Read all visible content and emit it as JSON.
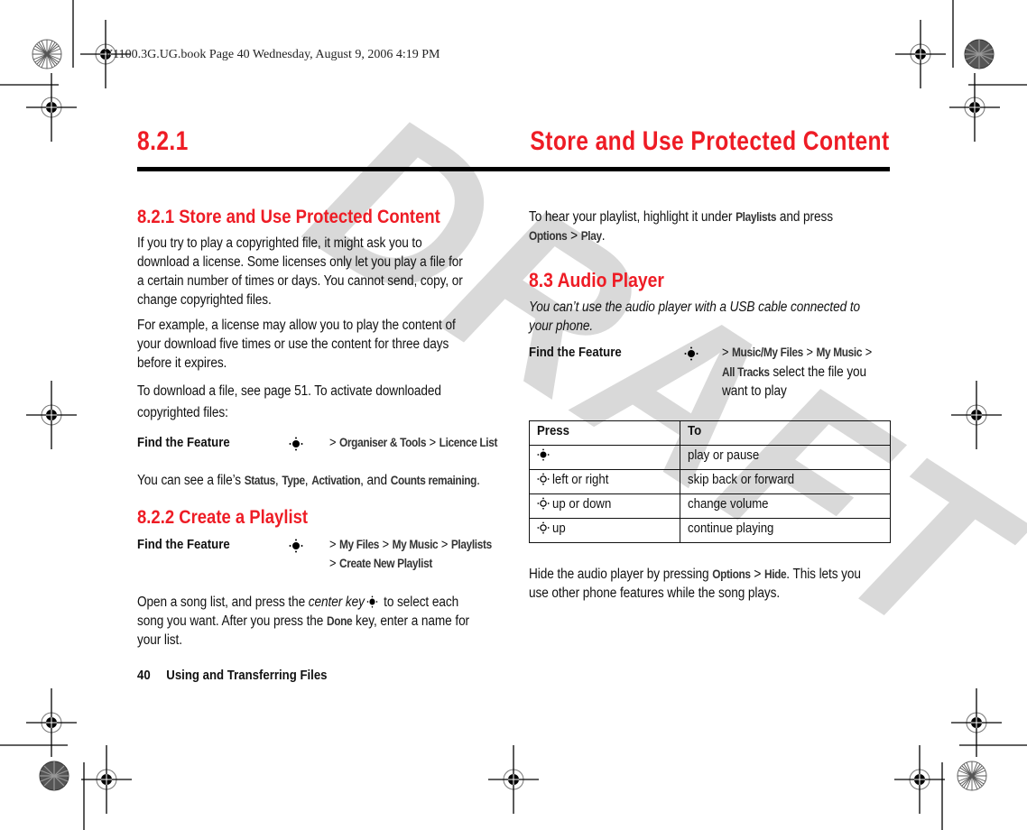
{
  "slug_line": "V1100.3G.UG.book  Page 40  Wednesday, August 9, 2006  4:19 PM",
  "header": {
    "section_number": "8.2.1",
    "section_title": "Store and Use Protected Content"
  },
  "watermark": "DRAFT",
  "accent_color": "#ee1c25",
  "left_column": {
    "heading_1": "8.2.1 Store and Use Protected Content",
    "para_1": [
      "If you try to play a copyrighted file, it might ask you to",
      "download a license. Some licenses only let you play a file for",
      "a certain number of times or days. You cannot send, copy, or",
      "change copyrighted files."
    ],
    "para_2": [
      "For example, a license may allow you to play the content of",
      "your download five times or use the content for three days",
      "before it expires."
    ],
    "para_3": [
      "To download a file, see page 51. To activate downloaded",
      "copyrighted files:"
    ],
    "find_feature_1": {
      "label": "Find the Feature",
      "icon": "nav-key-center-icon",
      "path": [
        ">",
        "Organiser & Tools",
        ">",
        "Licence List"
      ]
    },
    "para_4": {
      "prefix": "You can see a file’s ",
      "items": [
        "Status",
        "Type",
        "Activation",
        "Counts remaining"
      ],
      "sep": ", ",
      "and": ", and ",
      "suffix": "."
    },
    "heading_2": "8.2.2 Create a Playlist",
    "find_feature_2": {
      "label": "Find the Feature",
      "icon": "nav-key-center-icon",
      "path_line1": [
        ">",
        "My Files",
        ">",
        "My Music",
        ">",
        "Playlists"
      ],
      "path_line2": [
        ">",
        "Create New Playlist"
      ]
    },
    "para_5": {
      "line1_a": "Open a song list, and press the ",
      "line1_em": "center key",
      "line1_b": " to select each",
      "line2_a": "song you want. After you press the ",
      "line2_ui": "Done",
      "line2_b": " key, enter a name for",
      "line3": "your list."
    }
  },
  "right_column": {
    "para_1": {
      "line1_a": "To hear your playlist, highlight it under ",
      "line1_ui": "Playlists",
      "line1_b": " and press",
      "line2_ui1": "Options",
      "line2_sep": " > ",
      "line2_ui2": "Play",
      "line2_end": "."
    },
    "heading_3": "8.3 Audio Player",
    "note": [
      "You can’t use the audio player with a USB cable connected to",
      "your phone."
    ],
    "find_feature_3": {
      "label": "Find the Feature",
      "icon": "nav-key-center-icon",
      "line1": [
        ">",
        "Music/My Files",
        ">",
        "My Music",
        ">"
      ],
      "line2_ui": "All Tracks",
      "line2_text": " select the file you",
      "line3": "want to play"
    },
    "table": {
      "headers": [
        "Press",
        "To"
      ],
      "rows": [
        {
          "icon": "nav-key-center-icon",
          "press": "",
          "to": "play or pause"
        },
        {
          "icon": "nav-key-icon",
          "press": "left or right",
          "to": "skip back or forward"
        },
        {
          "icon": "nav-key-icon",
          "press": "up or down",
          "to": "change volume"
        },
        {
          "icon": "nav-key-icon",
          "press": "up",
          "to": "continue playing"
        }
      ]
    },
    "para_2": {
      "line1_a": "Hide the audio player by pressing ",
      "line1_ui1": "Options",
      "line1_sep": " > ",
      "line1_ui2": "Hide",
      "line1_b": ". This lets you",
      "line2": "use other phone features while the song plays."
    }
  },
  "footer": {
    "page_number": "40",
    "chapter": "Using and Transferring Files"
  }
}
